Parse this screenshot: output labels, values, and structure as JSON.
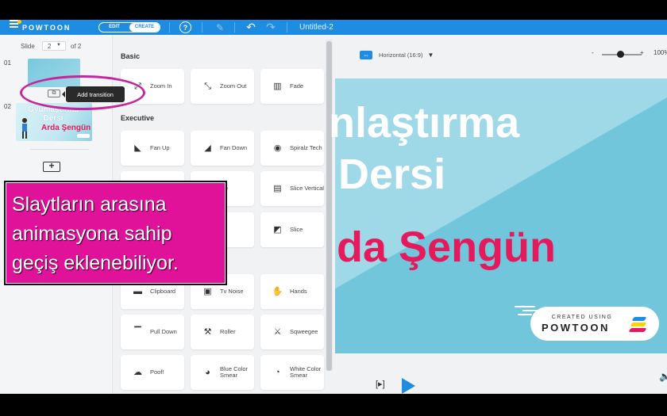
{
  "app": {
    "logo": "POWTOON",
    "mode_edit": "EDIT",
    "mode_create": "CREATE",
    "help": "?",
    "title": "Untitled-2"
  },
  "slides": {
    "label": "Slide",
    "current": "2",
    "total_label": "of 2",
    "items": [
      {
        "number": "01"
      },
      {
        "number": "02",
        "title": "Oyunlaştırma Dersi",
        "name": "Arda Şengün"
      }
    ],
    "add_transition_tooltip": "Add transition"
  },
  "transitions": {
    "sections": [
      {
        "heading": "Basic",
        "items": [
          {
            "label": "Zoom In",
            "icon": "zoom-in-icon",
            "glyph": "⤢"
          },
          {
            "label": "Zoom Out",
            "icon": "zoom-out-icon",
            "glyph": "⤡"
          },
          {
            "label": "Fade",
            "icon": "fade-icon",
            "glyph": "▥"
          }
        ]
      },
      {
        "heading": "Executive",
        "items": [
          {
            "label": "Fan Up",
            "icon": "fan-up-icon",
            "glyph": "◣"
          },
          {
            "label": "Fan Down",
            "icon": "fan-down-icon",
            "glyph": "◢"
          },
          {
            "label": "Spiralz Tech",
            "icon": "spiral-icon",
            "glyph": "◉"
          },
          {
            "label": "",
            "icon": "blank-icon",
            "glyph": ""
          },
          {
            "label": "ipe",
            "icon": "wipe-icon",
            "glyph": "▭"
          },
          {
            "label": "Slice Vertical",
            "icon": "slice-vertical-icon",
            "glyph": "▤"
          },
          {
            "label": "",
            "icon": "blank-icon",
            "glyph": ""
          },
          {
            "label": "r",
            "icon": "item-icon",
            "glyph": ""
          },
          {
            "label": "Slice",
            "icon": "slice-icon",
            "glyph": "◩"
          },
          {
            "label": "Clipboard",
            "icon": "clipboard-icon",
            "glyph": "▬"
          },
          {
            "label": "Tv Noise",
            "icon": "tv-noise-icon",
            "glyph": "▣"
          },
          {
            "label": "Hands",
            "icon": "hands-icon",
            "glyph": "✋"
          },
          {
            "label": "Pull Down",
            "icon": "pull-down-icon",
            "glyph": "▔"
          },
          {
            "label": "Roller",
            "icon": "roller-icon",
            "glyph": "⚒"
          },
          {
            "label": "Sqweegee",
            "icon": "squeegee-icon",
            "glyph": "⚔"
          },
          {
            "label": "Poof!",
            "icon": "poof-icon",
            "glyph": "☁"
          },
          {
            "label": "Blue Color Smear",
            "icon": "blue-smear-icon",
            "glyph": "◕"
          },
          {
            "label": "White Color Smear",
            "icon": "white-smear-icon",
            "glyph": "◔"
          }
        ]
      }
    ]
  },
  "stage": {
    "aspect_label": "Horizontal (16:9)",
    "zoom_minus": "-",
    "zoom_plus": "+",
    "zoom_value": "100%",
    "zoom_level_fraction": 0.45,
    "slide_line1": "nlaştırma",
    "slide_line2": "Dersi",
    "slide_line3": "da Şengün",
    "badge_top": "CREATED USING",
    "badge_logo": "POWTOON",
    "frame_play": "[▸]"
  },
  "overlay": {
    "line1": "Slaytların arasına",
    "line2": "animasyona sahip",
    "line3": "geçiş eklenebiliyor."
  },
  "colors": {
    "accent": "#1e8ce0",
    "brand_pink": "#e51a5d",
    "overlay": "#e0129a",
    "highlight_ring": "#c4269e"
  }
}
